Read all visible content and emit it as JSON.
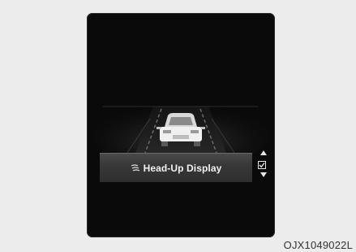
{
  "menu": {
    "selected_item_label": "Head-Up Display",
    "selected_item_icon": "head-up-display-icon",
    "checkbox_checked": true,
    "scroll_icons": [
      "chevron-up-icon",
      "chevron-down-icon"
    ]
  },
  "caption": "OJX1049022L",
  "colors": {
    "screen_background": "#0a0a0a",
    "selection_bar": "#3a3a3a",
    "text": "#f2f2f2",
    "page_background": "#ececec"
  }
}
